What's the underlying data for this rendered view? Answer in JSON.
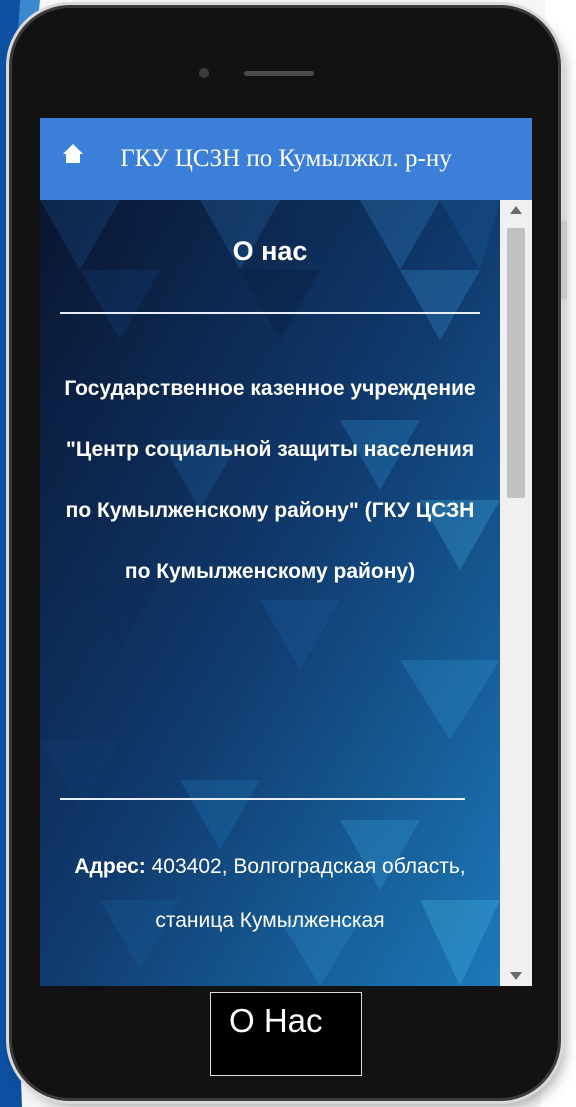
{
  "header": {
    "title": "ГКУ ЦСЗН по Кумылжкл. р-ну",
    "home_icon": "home-icon"
  },
  "main": {
    "heading": "О нас",
    "organization": "Государственное казенное учреждение \"Центр социальной защиты населения по Кумылженскому району\" (ГКУ ЦСЗН по Кумылженскому району)",
    "address_label": "Адрес:",
    "address_value": " 403402, Волгоградская область, станица Кумылженская"
  },
  "bottom_nav": {
    "about_label": "О Нас"
  },
  "colors": {
    "titlebar": "#3c7fd8",
    "content_bg": "#0b1a3d",
    "accent": "#1f6fb5"
  }
}
